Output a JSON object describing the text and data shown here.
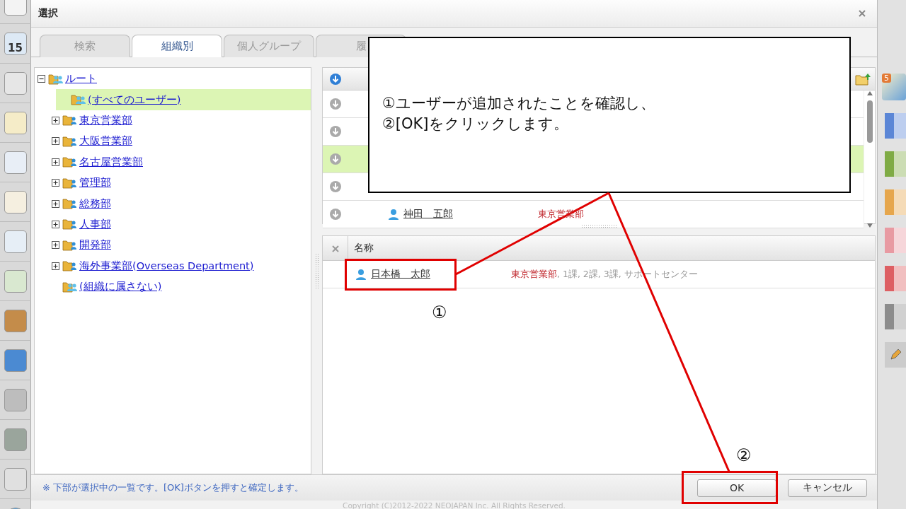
{
  "app_sidebar": {
    "calendar_day": "15"
  },
  "dialog": {
    "title": "選択"
  },
  "tabs": [
    {
      "label": "検索",
      "selected": false
    },
    {
      "label": "組織別",
      "selected": true
    },
    {
      "label": "個人グループ",
      "selected": false
    },
    {
      "label": "履",
      "selected": false
    }
  ],
  "tree": {
    "items": [
      {
        "label": "ルート",
        "kind": "group",
        "expanded": true,
        "selected": false,
        "children": [
          {
            "label": "(すべてのユーザー)",
            "kind": "group",
            "selected": true
          },
          {
            "label": "東京営業部",
            "kind": "org",
            "expanded": false,
            "selected": false
          },
          {
            "label": "大阪営業部",
            "kind": "org",
            "expanded": false,
            "selected": false
          },
          {
            "label": "名古屋営業部",
            "kind": "org",
            "expanded": false,
            "selected": false
          },
          {
            "label": "管理部",
            "kind": "org",
            "expanded": false,
            "selected": false
          },
          {
            "label": "総務部",
            "kind": "org",
            "expanded": false,
            "selected": false
          },
          {
            "label": "人事部",
            "kind": "org",
            "expanded": false,
            "selected": false
          },
          {
            "label": "開発部",
            "kind": "org",
            "expanded": false,
            "selected": false
          },
          {
            "label": "海外事業部(Overseas Department)",
            "kind": "org",
            "expanded": false,
            "selected": false
          },
          {
            "label": "(組織に属さない)",
            "kind": "group",
            "selected": false
          }
        ]
      }
    ]
  },
  "user_list": {
    "rows": [
      {
        "selected": false
      },
      {
        "selected": false
      },
      {
        "selected": true
      },
      {
        "selected": false
      },
      {
        "selected": false,
        "name": "神田　五郎",
        "department": "東京営業部"
      }
    ]
  },
  "selected_panel": {
    "column": "名称",
    "rows": [
      {
        "name": "日本橋　太郎",
        "department": "東京営業部",
        "groups": ", 1課, 2課, 3課, サポートセンター"
      }
    ]
  },
  "footer": {
    "note": "※ 下部が選択中の一覧です。[OK]ボタンを押すと確定します。",
    "buttons": [
      "OK",
      "キャンセル"
    ]
  },
  "copyright": "Copyright (C)2012-2022 NEOJAPAN Inc. All Rights Reserved.",
  "right_strip": {
    "badge": "5",
    "tabs": [
      {
        "color": "#5b86d6"
      },
      {
        "color": "#7fab45"
      },
      {
        "color": "#e6a64c"
      },
      {
        "color": "#e89aa2"
      },
      {
        "color": "#dd5f63"
      },
      {
        "color": "#8c8c8c"
      }
    ]
  },
  "annotation": {
    "callout": [
      "①ユーザーが追加されたことを確認し、",
      "②[OK]をクリックします。"
    ],
    "markers": [
      "①",
      "②"
    ]
  }
}
